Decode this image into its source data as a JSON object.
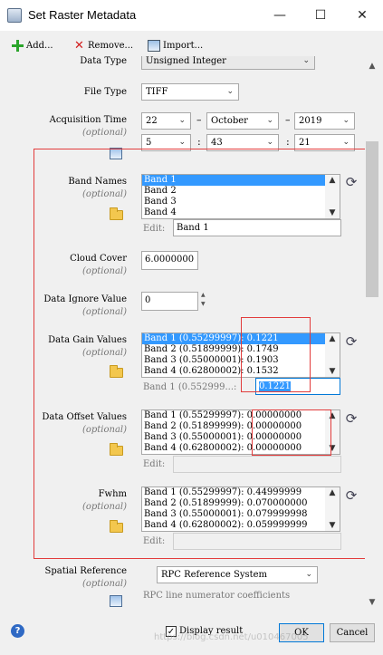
{
  "window": {
    "title": "Set Raster Metadata",
    "minimize": "—",
    "maximize": "☐",
    "close": "✕"
  },
  "toolbar": {
    "add_label": "Add...",
    "remove_label": "Remove...",
    "import_label": "Import..."
  },
  "fields": {
    "data_type": {
      "label": "Data Type",
      "value": "Unsigned Integer"
    },
    "file_type": {
      "label": "File Type",
      "value": "TIFF"
    },
    "acquisition_time": {
      "label": "Acquisition Time",
      "optional": "(optional)",
      "day": "22",
      "month": "October",
      "year": "2019",
      "hour": "5",
      "minute": "43",
      "second": "21",
      "sep_dash": "–",
      "sep_colon": ":"
    },
    "band_names": {
      "label": "Band Names",
      "optional": "(optional)",
      "items": [
        "Band 1",
        "Band 2",
        "Band 3",
        "Band 4"
      ],
      "selected": 0,
      "edit_label": "Edit:",
      "edit_value": "Band 1"
    },
    "cloud_cover": {
      "label": "Cloud Cover",
      "optional": "(optional)",
      "value": "6.0000000"
    },
    "data_ignore_value": {
      "label": "Data Ignore Value",
      "optional": "(optional)",
      "value": "0"
    },
    "data_gain_values": {
      "label": "Data Gain Values",
      "optional": "(optional)",
      "items": [
        "Band 1 (0.55299997): 0.1221",
        "Band 2 (0.51899999): 0.1749",
        "Band 3 (0.55000001): 0.1903",
        "Band 4 (0.62800002): 0.1532"
      ],
      "selected": 0,
      "edit_label": "Band 1 (0.552999...:",
      "edit_value": "0.1221"
    },
    "data_offset_values": {
      "label": "Data Offset Values",
      "optional": "(optional)",
      "items": [
        "Band 1 (0.55299997): 0.00000000",
        "Band 2 (0.51899999): 0.00000000",
        "Band 3 (0.55000001): 0.00000000",
        "Band 4 (0.62800002): 0.00000000"
      ],
      "edit_label": "Edit:"
    },
    "fwhm": {
      "label": "Fwhm",
      "optional": "(optional)",
      "items": [
        "Band 1 (0.55299997): 0.44999999",
        "Band 2 (0.51899999): 0.070000000",
        "Band 3 (0.55000001): 0.079999998",
        "Band 4 (0.62800002): 0.059999999"
      ],
      "edit_label": "Edit:"
    },
    "spatial_reference": {
      "label": "Spatial Reference",
      "optional": "(optional)",
      "value": "RPC Reference System",
      "sub_label": "RPC line numerator coefficients"
    }
  },
  "footer": {
    "help": "?",
    "display_result_label": "Display result",
    "display_result_checked": "✓",
    "ok_label": "OK",
    "cancel_label": "Cancel",
    "watermark": "https://blog.csdn.net/u010467005"
  },
  "icons": {
    "refresh": "⟳",
    "scroll_up": "▲",
    "scroll_down": "▼",
    "combo_arrow": "⌄",
    "spin_up": "▲",
    "spin_down": "▼"
  },
  "colors": {
    "selection": "#3399ff",
    "highlight_box": "#e23c3c",
    "default_button_border": "#0078d7"
  }
}
